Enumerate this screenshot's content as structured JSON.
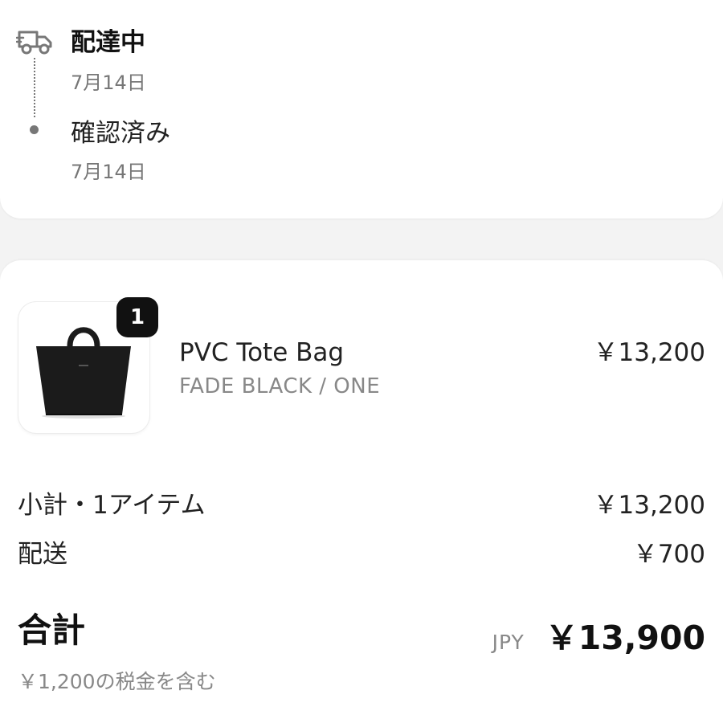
{
  "timeline": {
    "steps": [
      {
        "title": "配達中",
        "date": "7月14日"
      },
      {
        "title": "確認済み",
        "date": "7月14日"
      }
    ]
  },
  "icons": {
    "status": "delivery-truck-icon",
    "product": "tote-bag-image"
  },
  "product": {
    "quantity": "1",
    "name": "PVC Tote Bag",
    "variant": "FADE BLACK / ONE",
    "price": "￥13,200"
  },
  "summary": {
    "subtotal_label": "小計・1アイテム",
    "subtotal_value": "￥13,200",
    "shipping_label": "配送",
    "shipping_value": "￥700",
    "total_label": "合計",
    "currency": "JPY",
    "total_value": "￥13,900",
    "tax_note": "￥1,200の税金を含む"
  },
  "colors": {
    "background": "#f3f3f3",
    "card": "#ffffff",
    "text": "#111111",
    "muted": "#888888",
    "badge": "#111111"
  }
}
